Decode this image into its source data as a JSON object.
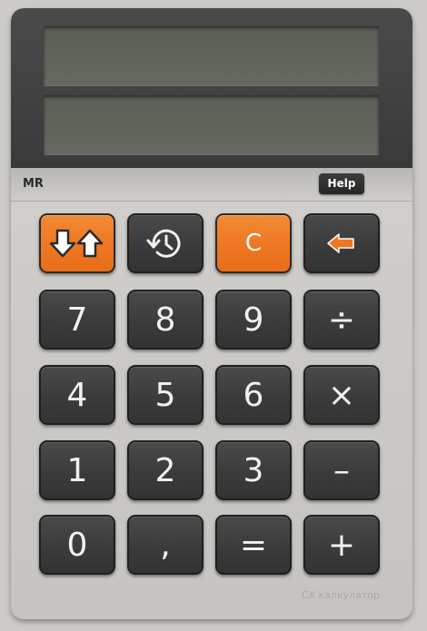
{
  "display": {
    "line1": "",
    "line2": ""
  },
  "memory": {
    "label": "MR"
  },
  "help": {
    "label": "Help"
  },
  "keys": {
    "swap": {
      "icon": "swap-arrows-icon"
    },
    "history": {
      "icon": "history-icon"
    },
    "clear": {
      "label": "C"
    },
    "backspace": {
      "icon": "backspace-arrow-icon"
    },
    "seven": "7",
    "eight": "8",
    "nine": "9",
    "divide": "÷",
    "four": "4",
    "five": "5",
    "six": "6",
    "multiply": "×",
    "one": "1",
    "two": "2",
    "three": "3",
    "minus": "–",
    "zero": "0",
    "comma": ",",
    "equals": "=",
    "plus": "+"
  },
  "brand": {
    "label": "CX калкулатор"
  },
  "colors": {
    "accent": "#ee7722",
    "key_dark": "#3b3b3b",
    "body": "#cdcbc7",
    "lcd": "#62655c"
  }
}
